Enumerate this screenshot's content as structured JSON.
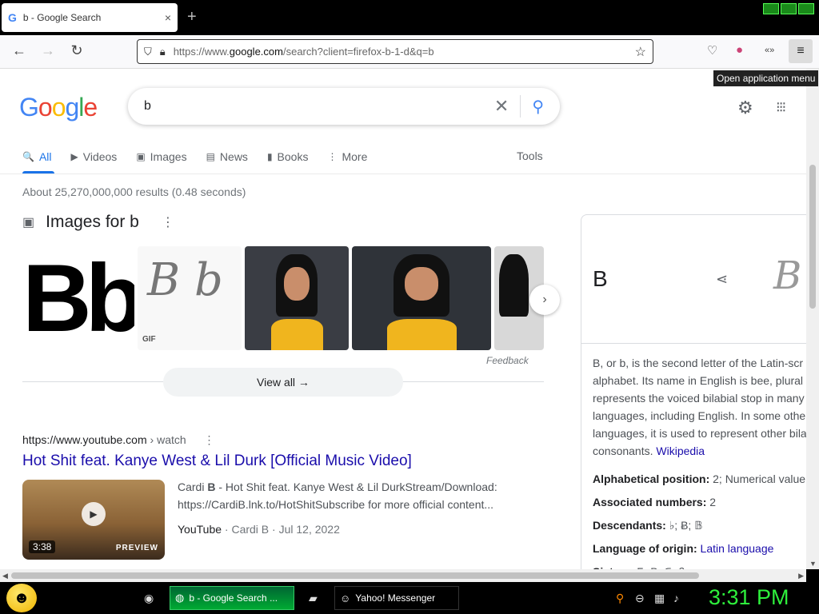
{
  "browser": {
    "tab_title": "b - Google Search",
    "tab_favicon": "G",
    "tab_close": "×",
    "new_tab": "+",
    "url_prefix": "https://www.",
    "url_domain": "google.com",
    "url_rest": "/search?client=firefox-b-1-d&q=b",
    "tooltip": "Open application menu"
  },
  "google": {
    "logo_letters": [
      "G",
      "o",
      "o",
      "g",
      "l",
      "e"
    ],
    "logo_colors": [
      "#4285f4",
      "#ea4335",
      "#fbbc05",
      "#4285f4",
      "#34a853",
      "#ea4335"
    ],
    "query": "b",
    "tabs": [
      {
        "label": "All",
        "icon": "🔍"
      },
      {
        "label": "Videos",
        "icon": "▶"
      },
      {
        "label": "Images",
        "icon": "▣"
      },
      {
        "label": "News",
        "icon": "▤"
      },
      {
        "label": "Books",
        "icon": "▮"
      },
      {
        "label": "More",
        "icon": "⋮"
      }
    ],
    "tools": "Tools",
    "stats": "About 25,270,000,000 results (0.48 seconds)"
  },
  "images": {
    "heading": "Images for b",
    "thumb1_text": "Bb",
    "thumb2_text": "B b",
    "thumb2_badge": "GIF",
    "feedback": "Feedback",
    "view_all": "View all  →"
  },
  "result": {
    "url": "https://www.youtube.com",
    "crumb": " › watch",
    "title": "Hot Shit feat. Kanye West & Lil Durk [Official Music Video]",
    "duration": "3:38",
    "preview": "PREVIEW",
    "snippet_bold": "B",
    "snippet_pre": "Cardi ",
    "snippet_post": " - Hot Shit feat. Kanye West & Lil DurkStream/Download: https://CardiB.lnk.to/HotShitSubscribe for more official content...",
    "source": "YouTube",
    "meta": " · Cardi B · Jul 12, 2022"
  },
  "knowledge": {
    "title": "B",
    "image_glyph": "B",
    "desc_lines": [
      "B, or b, is the second letter of the Latin-scr",
      "alphabet. Its name in English is bee, plural",
      "represents the voiced bilabial stop in many",
      "languages, including English. In some othe",
      "languages, it is used to represent other bila",
      "consonants. "
    ],
    "wiki_link": "Wikipedia",
    "facts": [
      {
        "label": "Alphabetical position:",
        "value": " 2; Numerical value"
      },
      {
        "label": "Associated numbers:",
        "value": " 2"
      },
      {
        "label": "Descendants:",
        "value": " ♭; Ƀ; 𝔹"
      },
      {
        "label": "Language of origin:",
        "value": "",
        "link": "Latin language"
      },
      {
        "label": "Sisters:",
        "value": " Б; В; Ϭ; β ..."
      }
    ]
  },
  "taskbar": {
    "task1": "b - Google Search ...",
    "task2": "Yahoo! Messenger",
    "clock": "3:31 PM"
  }
}
